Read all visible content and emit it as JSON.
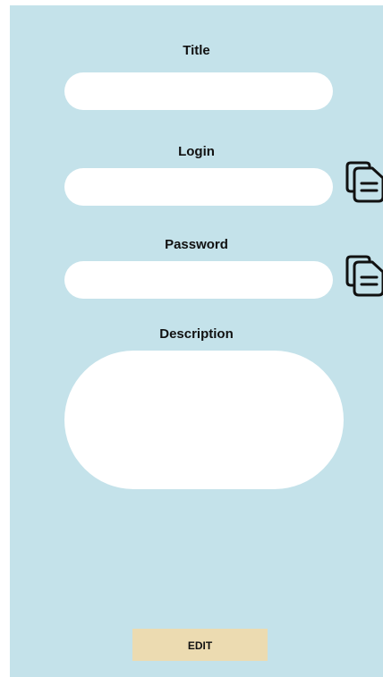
{
  "form": {
    "title_label": "Title",
    "title_value": "",
    "login_label": "Login",
    "login_value": "",
    "password_label": "Password",
    "password_value": "",
    "description_label": "Description",
    "description_value": ""
  },
  "icons": {
    "login_copy": "copy-icon",
    "password_copy": "copy-icon"
  },
  "actions": {
    "edit_label": "EDIT"
  },
  "colors": {
    "background": "#c4e2ea",
    "field": "#ffffff",
    "edit_button": "#ecdbb1",
    "text": "#111111"
  }
}
